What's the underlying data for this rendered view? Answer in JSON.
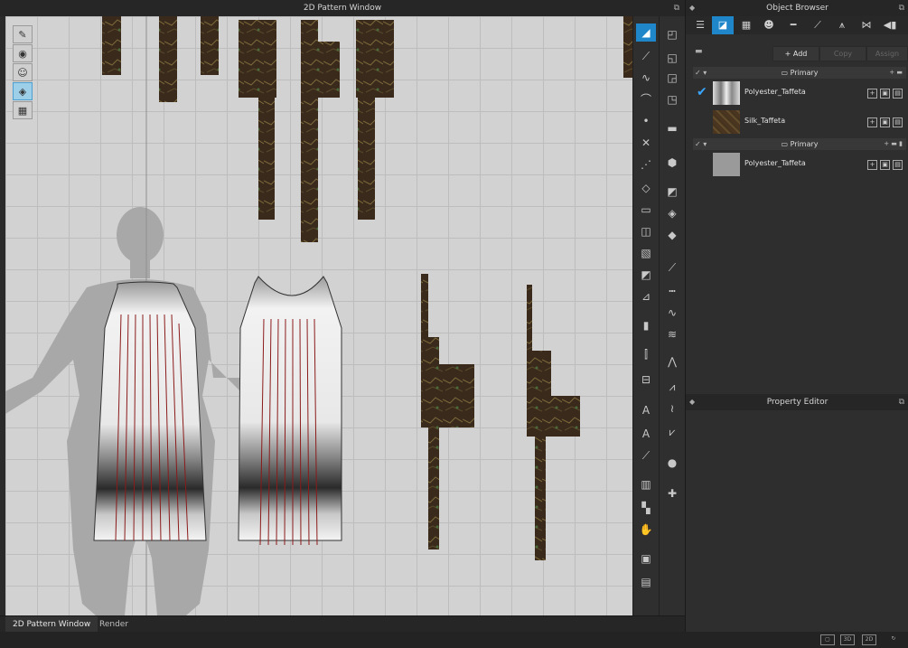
{
  "pattern_window": {
    "title": "2D Pattern Window",
    "dock_icon": "undock-icon"
  },
  "left_tools": [
    "transform-pattern-icon",
    "visibility-icon",
    "avatar-view-icon",
    "texture-view-icon",
    "arrangement-icon"
  ],
  "bottom_tabs": [
    {
      "label": "2D Pattern Window",
      "active": true
    },
    {
      "label": "Render",
      "active": false
    }
  ],
  "object_browser": {
    "title": "Object Browser",
    "tabs": [
      "list-icon",
      "fabric-icon",
      "button-icon",
      "buttonhole-icon",
      "topstitch-icon",
      "trim-icon",
      "zipper-icon",
      "bow-icon",
      "more-icon"
    ],
    "actions": {
      "add": "Add",
      "copy": "Copy",
      "assign": "Assign"
    },
    "groups": [
      {
        "label": "Primary",
        "fabrics": [
          {
            "name": "Polyester_Taffeta",
            "checked": true,
            "thumb": "print"
          },
          {
            "name": "Silk_Taffeta",
            "checked": false,
            "thumb": "bark"
          }
        ]
      },
      {
        "label": "Primary",
        "fabrics": [
          {
            "name": "Polyester_Taffeta",
            "checked": false,
            "thumb": "gray"
          }
        ]
      }
    ]
  },
  "property_editor": {
    "title": "Property Editor"
  },
  "status_icons": [
    "single-view-icon",
    "3d-view-icon",
    "2d-view-icon",
    "refresh-icon"
  ],
  "colors": {
    "accent": "#1f87c9",
    "pattern_line": "#8b1a1a",
    "canvas_bg": "#d2d2d2",
    "panel_bg": "#2e2e2e"
  }
}
